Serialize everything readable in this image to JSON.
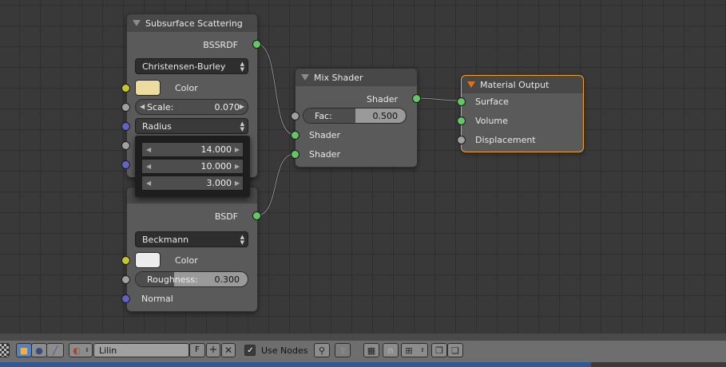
{
  "nodes": {
    "sss": {
      "title": "Subsurface Scattering",
      "output": "BSSRDF",
      "falloff": "Christensen-Burley",
      "color_label": "Color",
      "color": "#ecdca0",
      "scale_label": "Scale:",
      "scale_value": "0.070",
      "radius_label": "Radius",
      "radius_values": [
        "14.000",
        "10.000",
        "3.000"
      ]
    },
    "glossy": {
      "output": "BSDF",
      "distribution": "Beckmann",
      "color_label": "Color",
      "color": "#ececec",
      "roughness_label": "Roughness:",
      "roughness_value": "0.300",
      "roughness": 0.3,
      "normal_label": "Normal"
    },
    "mix": {
      "title": "Mix Shader",
      "output": "Shader",
      "fac_label": "Fac:",
      "fac_value": "0.500",
      "fac": 0.5,
      "input1": "Shader",
      "input2": "Shader"
    },
    "output": {
      "title": "Material Output",
      "surface": "Surface",
      "volume": "Volume",
      "displacement": "Displacement"
    }
  },
  "header": {
    "material_name": "Lilin",
    "fake_user": "F",
    "use_nodes_label": "Use Nodes",
    "use_nodes_checked": true
  },
  "colors": {
    "shader_socket": "#63c763",
    "color_socket": "#c7c729",
    "value_socket": "#a1a1a1",
    "vector_socket": "#6363c7",
    "active_border": "#f0a030"
  }
}
